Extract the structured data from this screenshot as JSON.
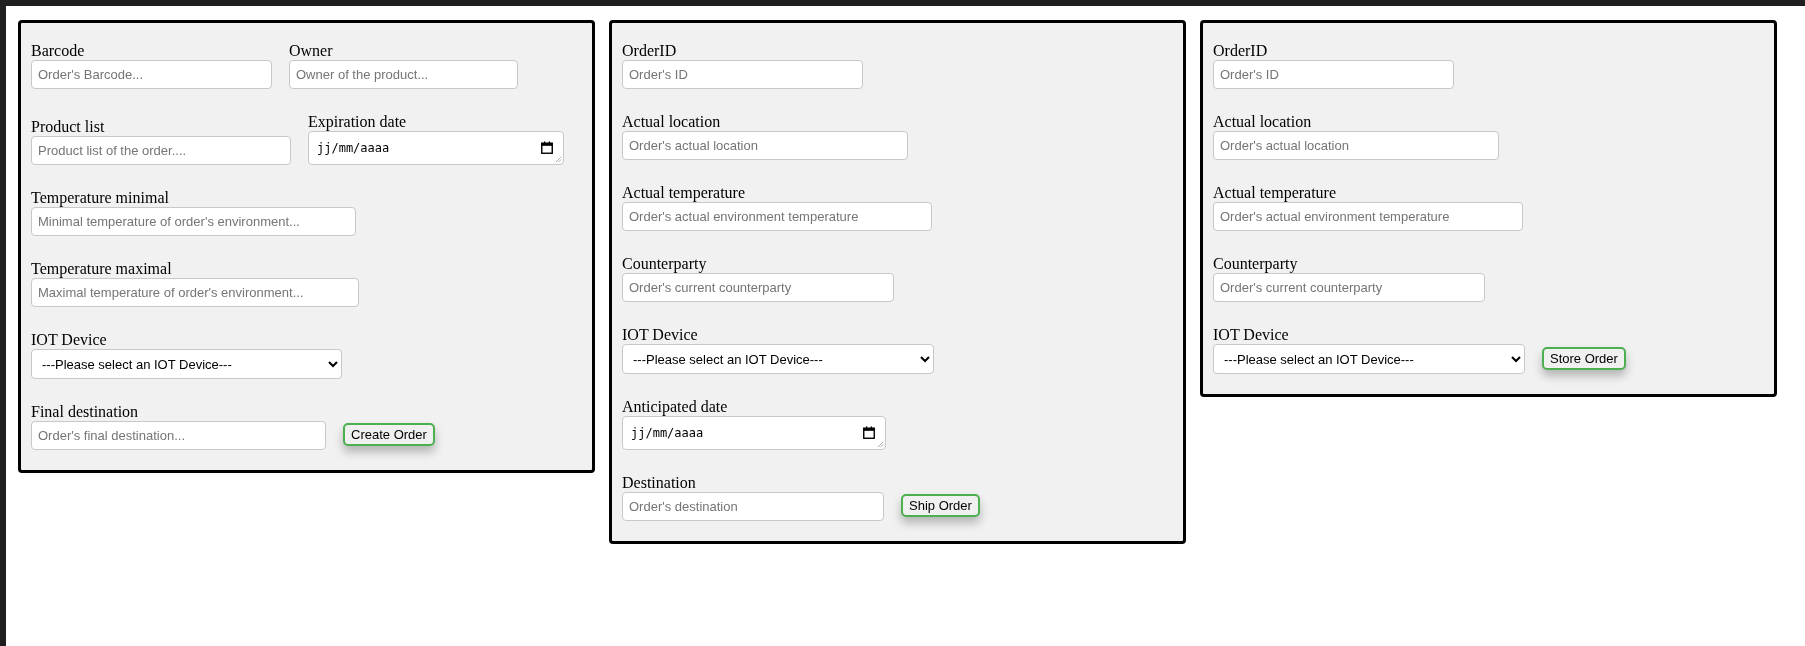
{
  "forms": [
    {
      "rows": [
        {
          "fields": [
            {
              "label": "Barcode",
              "kind": "text",
              "placeholder": "Order's Barcode..."
            },
            {
              "label": "Owner",
              "kind": "text",
              "placeholder": "Owner of the product..."
            }
          ]
        },
        {
          "fields": [
            {
              "label": "Product list",
              "kind": "text",
              "placeholder": "Product list of the order...."
            },
            {
              "label": "Expiration date",
              "kind": "date",
              "value": "jj/mm/aaaa"
            }
          ]
        },
        {
          "fields": [
            {
              "label": "Temperature minimal",
              "kind": "text",
              "placeholder": "Minimal temperature of order's environment..."
            }
          ]
        },
        {
          "fields": [
            {
              "label": "Temperature maximal",
              "kind": "text",
              "placeholder": "Maximal temperature of order's environment..."
            }
          ]
        },
        {
          "fields": [
            {
              "label": "IOT Device",
              "kind": "select",
              "value": "---Please select an IOT Device---"
            }
          ]
        },
        {
          "fields": [
            {
              "label": "Final destination",
              "kind": "text",
              "placeholder": "Order's final destination..."
            }
          ]
        }
      ],
      "button": "Create Order"
    },
    {
      "rows": [
        {
          "fields": [
            {
              "label": "OrderID",
              "kind": "text",
              "placeholder": "Order's ID"
            }
          ]
        },
        {
          "fields": [
            {
              "label": "Actual location",
              "kind": "text",
              "placeholder": "Order's actual location"
            }
          ]
        },
        {
          "fields": [
            {
              "label": "Actual temperature",
              "kind": "text",
              "placeholder": "Order's actual environment temperature"
            }
          ]
        },
        {
          "fields": [
            {
              "label": "Counterparty",
              "kind": "text",
              "placeholder": "Order's current counterparty"
            }
          ]
        },
        {
          "fields": [
            {
              "label": "IOT Device",
              "kind": "select",
              "value": "---Please select an IOT Device---"
            }
          ]
        },
        {
          "fields": [
            {
              "label": "Anticipated date",
              "kind": "date",
              "value": "jj/mm/aaaa"
            }
          ]
        },
        {
          "fields": [
            {
              "label": "Destination",
              "kind": "text",
              "placeholder": "Order's destination"
            }
          ]
        }
      ],
      "button": "Ship Order"
    },
    {
      "rows": [
        {
          "fields": [
            {
              "label": "OrderID",
              "kind": "text",
              "placeholder": "Order's ID"
            }
          ]
        },
        {
          "fields": [
            {
              "label": "Actual location",
              "kind": "text",
              "placeholder": "Order's actual location"
            }
          ]
        },
        {
          "fields": [
            {
              "label": "Actual temperature",
              "kind": "text",
              "placeholder": "Order's actual environment temperature"
            }
          ]
        },
        {
          "fields": [
            {
              "label": "Counterparty",
              "kind": "text",
              "placeholder": "Order's current counterparty"
            }
          ]
        },
        {
          "fields": [
            {
              "label": "IOT Device",
              "kind": "select",
              "value": "---Please select an IOT Device---"
            }
          ]
        }
      ],
      "button": "Store Order"
    }
  ]
}
